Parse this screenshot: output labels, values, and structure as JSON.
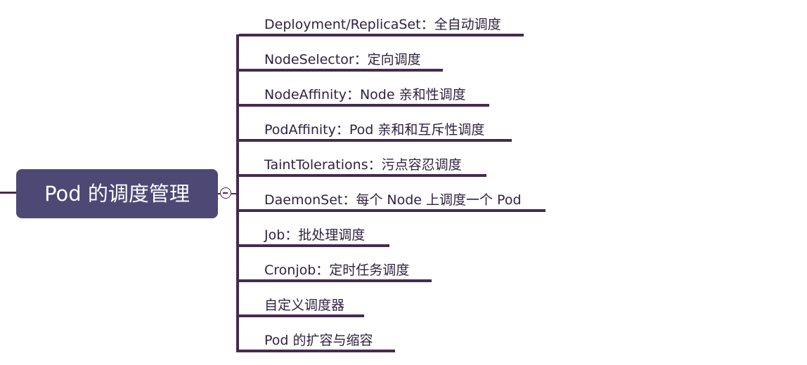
{
  "central_topic": {
    "label": "Pod 的调度管理"
  },
  "branches": [
    {
      "label": "Deployment/ReplicaSet：全自动调度"
    },
    {
      "label": "NodeSelector：定向调度"
    },
    {
      "label": "NodeAffinity：Node 亲和性调度"
    },
    {
      "label": "PodAffinity：Pod 亲和和互斥性调度"
    },
    {
      "label": "TaintTolerations：污点容忍调度"
    },
    {
      "label": "DaemonSet：每个 Node 上调度一个 Pod"
    },
    {
      "label": "Job：批处理调度"
    },
    {
      "label": "Cronjob：定时任务调度"
    },
    {
      "label": "自定义调度器"
    },
    {
      "label": "Pod 的扩容与缩容"
    }
  ],
  "colors": {
    "central_fill": "#4e4875",
    "line": "#472a4f",
    "text": "#2f2240"
  },
  "icons": {
    "toggle": "collapse-minus-icon"
  }
}
